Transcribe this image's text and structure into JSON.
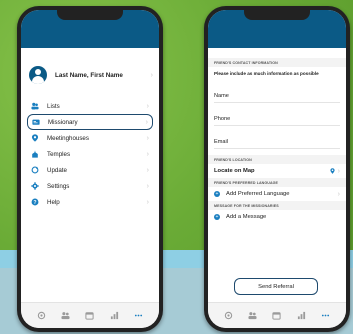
{
  "left_phone": {
    "profile_name": "Last Name, First Name",
    "menu": [
      {
        "label": "Lists",
        "icon": "people-icon",
        "selected": false
      },
      {
        "label": "Missionary",
        "icon": "card-icon",
        "selected": true
      },
      {
        "label": "Meetinghouses",
        "icon": "location-icon",
        "selected": false
      },
      {
        "label": "Temples",
        "icon": "temple-icon",
        "selected": false
      },
      {
        "label": "Update",
        "icon": "refresh-icon",
        "selected": false
      },
      {
        "label": "Settings",
        "icon": "gear-icon",
        "selected": false
      },
      {
        "label": "Help",
        "icon": "help-icon",
        "selected": false
      }
    ]
  },
  "right_phone": {
    "contact_header": "FRIEND'S CONTACT INFORMATION",
    "contact_note": "Please include as much information as possible",
    "fields": [
      "Name",
      "Phone",
      "Email"
    ],
    "location_header": "FRIEND'S LOCATION",
    "locate_label": "Locate on Map",
    "language_header": "FRIEND'S PREFERRED LANGUAGE",
    "add_language_label": "Add Preferred Language",
    "message_header": "MESSAGE FOR THE MISSIONARIES",
    "add_message_label": "Add a Message",
    "send_button_label": "Send Referral"
  },
  "bottom_tabs": [
    "home-icon",
    "people-icon",
    "calendar-icon",
    "chart-icon",
    "more-icon"
  ],
  "colors": {
    "header": "#0b5a86",
    "accent": "#1a7fc0",
    "outline": "#1e4a6e"
  }
}
